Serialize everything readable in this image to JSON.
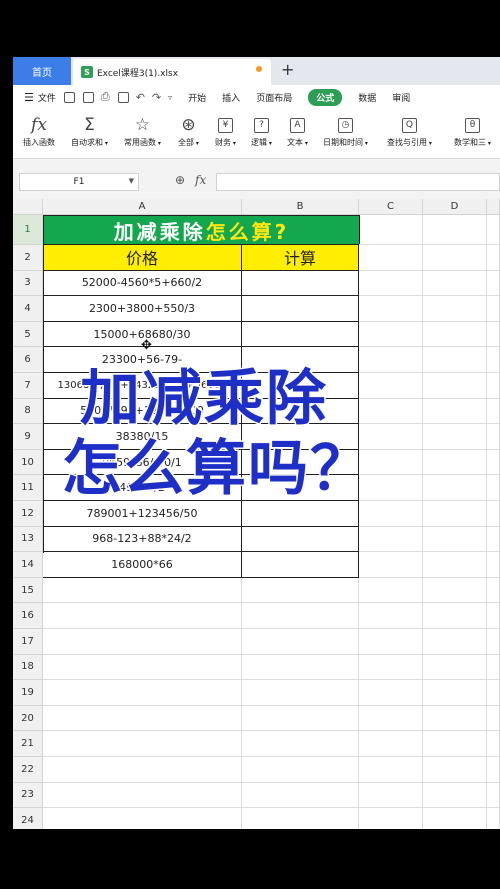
{
  "tabs": {
    "home": "首页",
    "file_icon": "S",
    "file_name": "Excel课程3(1).xlsx",
    "new_tab": "+"
  },
  "menu": {
    "file": "文件",
    "tabs": [
      "开始",
      "插入",
      "页面布局",
      "公式",
      "数据",
      "审阅"
    ],
    "active": "公式"
  },
  "ribbon": [
    {
      "icon": "fx",
      "label": "插入函数"
    },
    {
      "icon": "Σ",
      "label": "自动求和"
    },
    {
      "icon": "☆",
      "label": "常用函数"
    },
    {
      "icon": "⊛",
      "label": "全部"
    },
    {
      "icon": "¥",
      "label": "财务"
    },
    {
      "icon": "?",
      "label": "逻辑"
    },
    {
      "icon": "A",
      "label": "文本"
    },
    {
      "icon": "◷",
      "label": "日期和时间"
    },
    {
      "icon": "Q",
      "label": "查找与引用"
    },
    {
      "icon": "θ",
      "label": "数学和三"
    }
  ],
  "formula_bar": {
    "name_box": "F1",
    "fx_label": "fx",
    "value": ""
  },
  "grid": {
    "columns": [
      "A",
      "B",
      "C",
      "D"
    ],
    "rows": [
      "1",
      "2",
      "3",
      "4",
      "5",
      "6",
      "7",
      "8",
      "9",
      "10",
      "11",
      "12",
      "13",
      "14",
      "15",
      "16",
      "17",
      "18",
      "19",
      "20",
      "21",
      "22",
      "23",
      "24"
    ],
    "title_main": "加减乘除",
    "title_highlight": "怎么算?",
    "header_price": "价格",
    "header_calc": "计算",
    "formulas": [
      "52000-4560*5+660/2",
      "2300+3800+550/3",
      "15000+68680/30",
      "23300+56-79-",
      "13068*7/1-6+5432168*56-56664",
      "590*7890+1239-4500",
      "38380/15",
      "9659*86/6/0/1",
      "49000/2",
      "789001+123456/50",
      "968-123+88*24/2",
      "168000*66"
    ]
  },
  "overlay": {
    "line1": "加减乘除",
    "line2": "怎么算吗？"
  }
}
